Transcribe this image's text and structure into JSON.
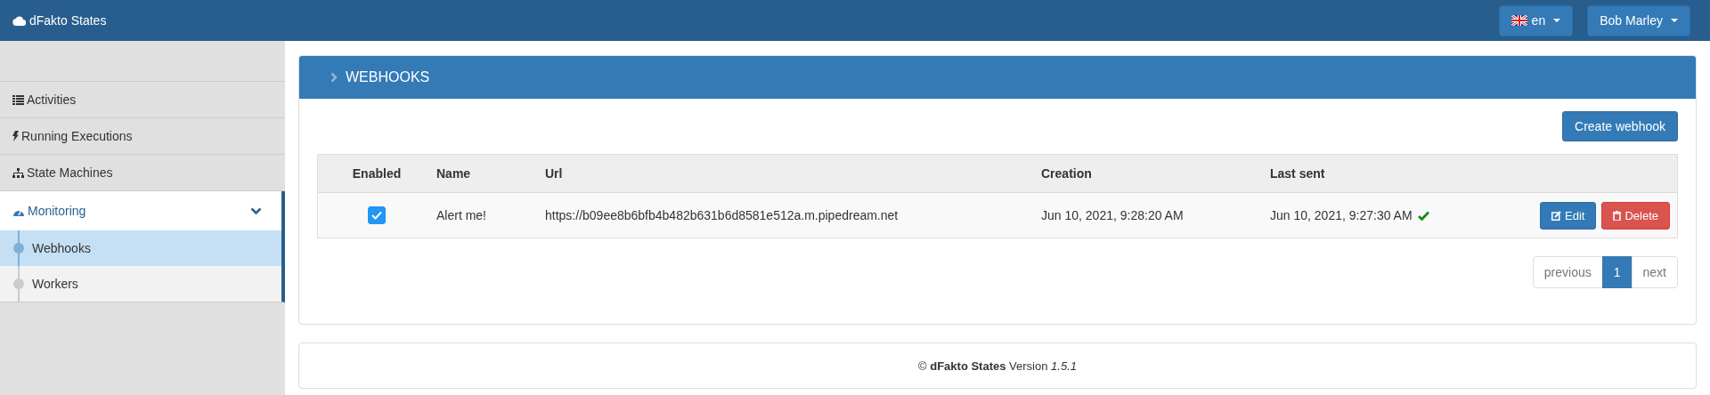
{
  "navbar": {
    "brand": "dFakto States",
    "language": "en",
    "user": "Bob Marley"
  },
  "sidebar": {
    "items": [
      {
        "label": "Activities",
        "selected": false
      },
      {
        "label": "Running Executions",
        "selected": false
      },
      {
        "label": "State Machines",
        "selected": false
      },
      {
        "label": "Monitoring",
        "selected": true,
        "expanded": true,
        "children": [
          {
            "label": "Webhooks",
            "selected": true
          },
          {
            "label": "Workers",
            "selected": false
          }
        ]
      }
    ]
  },
  "panel": {
    "title": "WEBHOOKS",
    "create_button": "Create webhook",
    "table": {
      "columns": [
        "Enabled",
        "Name",
        "Url",
        "Creation",
        "Last sent"
      ],
      "rows": [
        {
          "enabled": true,
          "name": "Alert me!",
          "url": "https://b09ee8b6bfb4b482b631b6d8581e512a.m.pipedream.net",
          "creation": "Jun 10, 2021, 9:28:20 AM",
          "last_sent": "Jun 10, 2021, 9:27:30 AM",
          "sent_ok": true,
          "edit": "Edit",
          "delete": "Delete"
        }
      ]
    },
    "pagination": [
      {
        "label": "previous",
        "selected": false
      },
      {
        "label": "1",
        "selected": true
      },
      {
        "label": "next",
        "selected": false
      }
    ]
  },
  "footer": "© **dFakto States** Version *1.5.1*"
}
